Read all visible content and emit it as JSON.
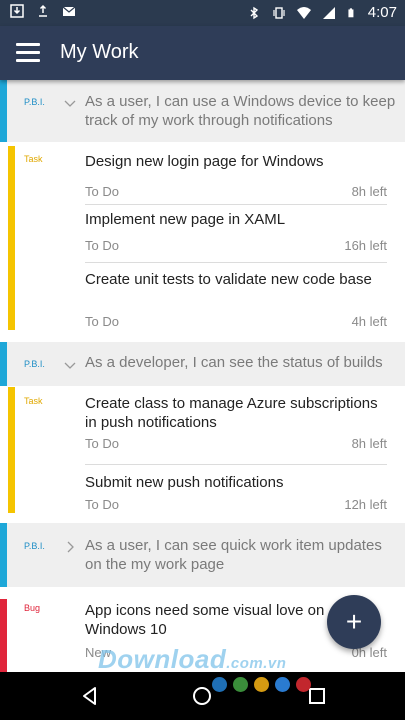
{
  "status_bar": {
    "time": "4:07"
  },
  "app_bar": {
    "title": "My Work"
  },
  "groups": [
    {
      "pbi_label": "P.B.I.",
      "pbi_text": "As a user, I can use a Windows device to keep track of my work through notifications",
      "type_label": "Task",
      "items": [
        {
          "title": "Design new login page for Windows",
          "state": "To Do",
          "remaining": "8h left"
        },
        {
          "title": "Implement new page in XAML",
          "state": "To Do",
          "remaining": "16h left"
        },
        {
          "title": "Create unit tests to validate new code base",
          "state": "To Do",
          "remaining": "4h left"
        }
      ]
    },
    {
      "pbi_label": "P.B.I.",
      "pbi_text": "As a developer, I can see the status of builds",
      "type_label": "Task",
      "items": [
        {
          "title": "Create class to manage Azure subscriptions in push notifications",
          "state": "To Do",
          "remaining": "8h left"
        },
        {
          "title": "Submit new push notifications",
          "state": "To Do",
          "remaining": "12h left"
        }
      ]
    },
    {
      "pbi_label": "P.B.I.",
      "pbi_text": "As a user, I can see quick work item updates on the my work page",
      "type_label": "Bug",
      "items": [
        {
          "title": "App icons need some visual love on Windows 10",
          "state": "New",
          "remaining": "0h left"
        }
      ]
    }
  ],
  "fab": {
    "label": "+"
  },
  "watermark": {
    "text": "Download",
    "suffix": ".com.vn"
  },
  "colors": {
    "pbi_bar": "#1ea7d8",
    "task_bar": "#f5c400",
    "bug_bar": "#e0253b",
    "app_bar": "#2f3d58"
  }
}
